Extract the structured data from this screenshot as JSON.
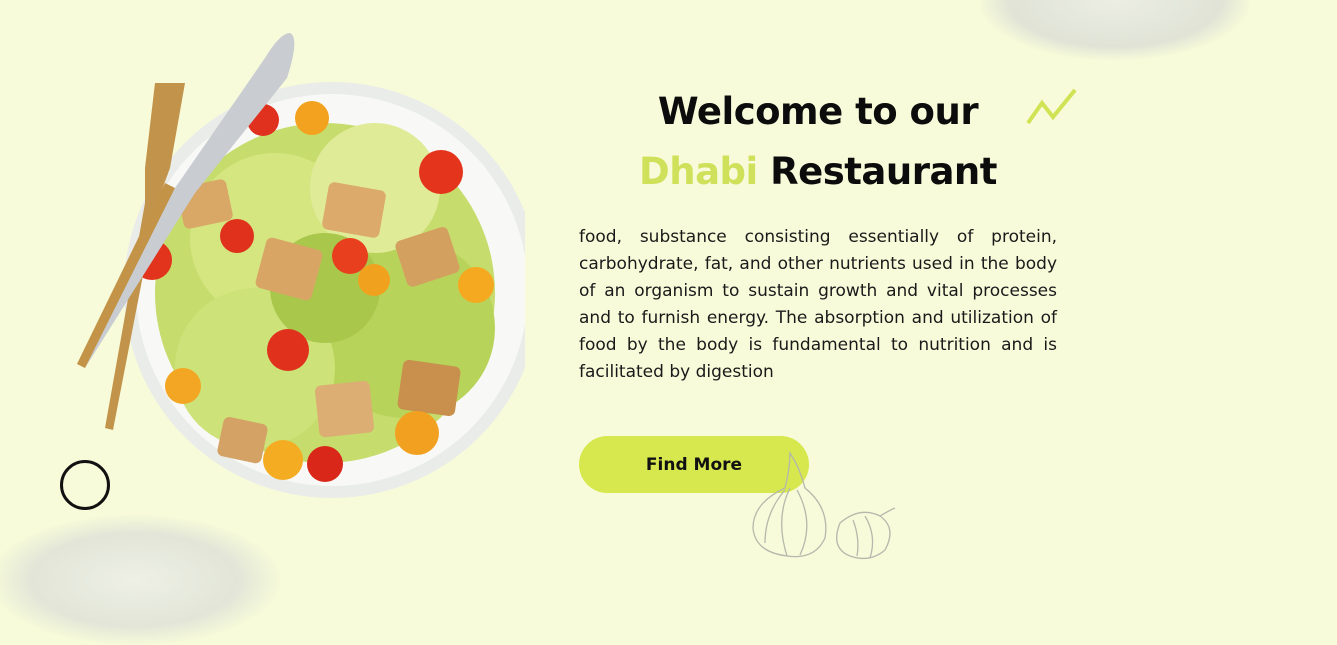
{
  "hero": {
    "title_line1": "Welcome to our",
    "title_accent": "Dhabi",
    "title_rest": "Restaurant",
    "description": "food, substance consisting essentially of protein, carbohydrate, fat, and other nutrients used in the body of an organism to sustain growth and vital processes and to furnish energy. The absorption and utilization of food by the body is fundamental to nutrition and is facilitated by digestion",
    "cta_label": "Find More"
  },
  "colors": {
    "background": "#f7fbd9",
    "accent": "#cfe15a",
    "button": "#d6e84e",
    "text": "#111111"
  },
  "icons": [
    "salad-plate-icon",
    "fork-icon",
    "knife-icon",
    "zigzag-icon",
    "garlic-icon",
    "lettuce-icon",
    "circle-outline-icon"
  ]
}
